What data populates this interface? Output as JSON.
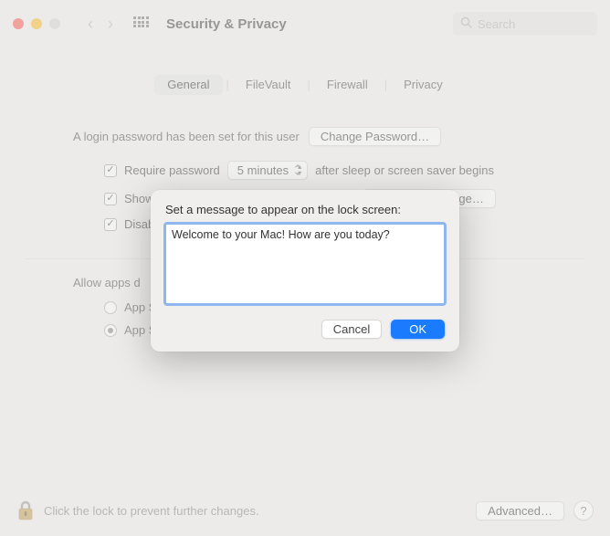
{
  "toolbar": {
    "title": "Security & Privacy",
    "search_placeholder": "Search"
  },
  "tabs": [
    "General",
    "FileVault",
    "Firewall",
    "Privacy"
  ],
  "login": {
    "text": "A login password has been set for this user",
    "change_btn": "Change Password…"
  },
  "checks": {
    "require_a": "Require password",
    "require_delay": "5 minutes",
    "require_b": "after sleep or screen saver begins",
    "show_msg": "Show a message when the screen is locked",
    "set_lock_btn": "Set Lock Message…",
    "disable": "Disab"
  },
  "allow": {
    "label": "Allow apps d",
    "opt1": "App S",
    "opt2": "App Store and identified developers"
  },
  "footer": {
    "text": "Click the lock to prevent further changes.",
    "advanced": "Advanced…",
    "help": "?"
  },
  "modal": {
    "title": "Set a message to appear on the lock screen:",
    "value": "Welcome to your Mac! How are you today?",
    "cancel": "Cancel",
    "ok": "OK"
  }
}
